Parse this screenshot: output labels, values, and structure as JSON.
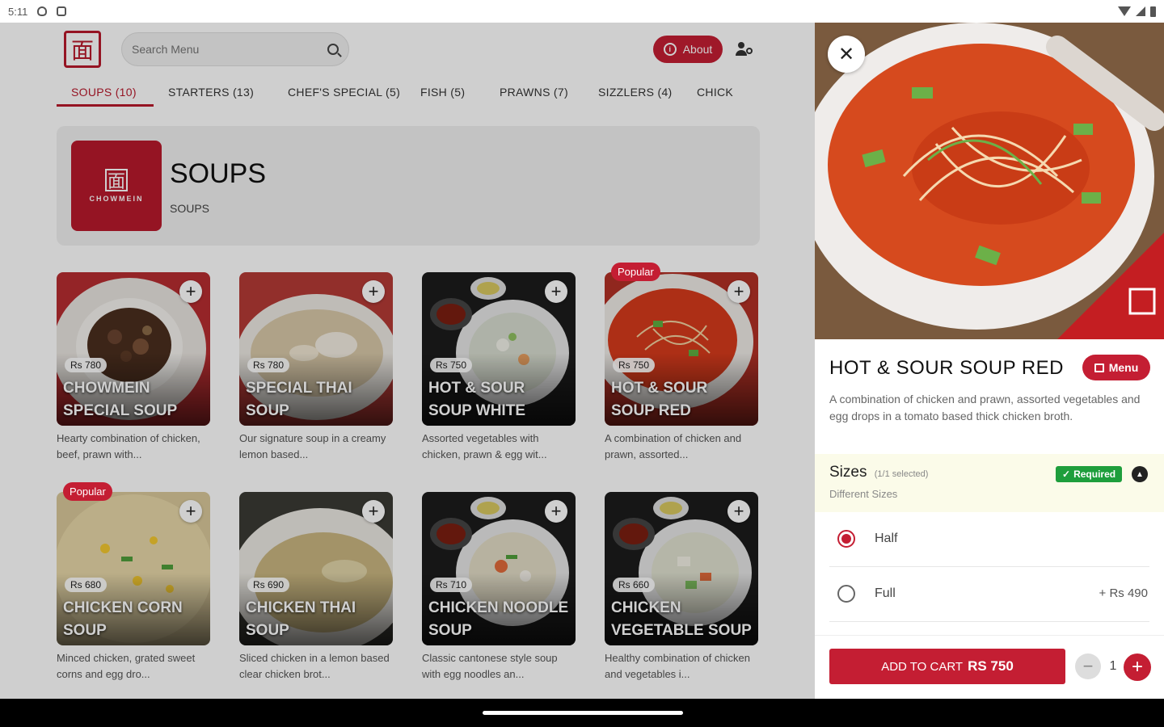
{
  "status": {
    "time": "5:11"
  },
  "header": {
    "logo_glyph": "面",
    "search": {
      "placeholder": "Search Menu",
      "value": ""
    },
    "about_label": "About",
    "about_icon": "i"
  },
  "tabs": [
    "SOUPS (10)",
    "STARTERS (13)",
    "CHEF'S SPECIAL (5)",
    "FISH (5)",
    "PRAWNS (7)",
    "SIZZLERS (4)",
    "CHICK"
  ],
  "category": {
    "logo_glyph": "面",
    "logo_text": "CHOWMEIN",
    "title": "SOUPS",
    "subtitle": "SOUPS"
  },
  "items": [
    {
      "price": "Rs 780",
      "name": "CHOWMEIN SPECIAL SOUP",
      "desc": "Hearty combination of chicken, beef, prawn with...",
      "popular": ""
    },
    {
      "price": "Rs 780",
      "name": "SPECIAL THAI SOUP",
      "desc": "Our signature soup in a creamy lemon based...",
      "popular": ""
    },
    {
      "price": "Rs 750",
      "name": "HOT & SOUR SOUP WHITE",
      "desc": "Assorted vegetables with chicken, prawn & egg wit...",
      "popular": ""
    },
    {
      "price": "Rs 750",
      "name": "HOT & SOUR SOUP RED",
      "desc": "A combination of chicken and prawn, assorted...",
      "popular": "Popular"
    },
    {
      "price": "Rs 680",
      "name": "CHICKEN CORN SOUP",
      "desc": "Minced chicken, grated sweet corns and egg dro...",
      "popular": "Popular"
    },
    {
      "price": "Rs 690",
      "name": "CHICKEN THAI SOUP",
      "desc": "Sliced chicken in a lemon based clear chicken brot...",
      "popular": ""
    },
    {
      "price": "Rs 710",
      "name": "CHICKEN NOODLE SOUP",
      "desc": "Classic cantonese style soup with egg noodles an...",
      "popular": ""
    },
    {
      "price": "Rs 660",
      "name": "CHICKEN VEGETABLE SOUP",
      "desc": "Healthy combination of chicken and vegetables i...",
      "popular": ""
    }
  ],
  "detail": {
    "close_glyph": "✕",
    "title": "HOT & SOUR SOUP RED",
    "menu_label": "Menu",
    "description": "A combination of chicken and prawn, assorted vegetables and egg drops in a tomato based thick chicken broth.",
    "sizes": {
      "title": "Sizes",
      "count": "(1/1 selected)",
      "subtitle": "Different Sizes",
      "required_label": "Required",
      "check_glyph": "✓",
      "collapse_glyph": "▲"
    },
    "options": [
      {
        "label": "Half",
        "price": "",
        "selected": true
      },
      {
        "label": "Full",
        "price": "+ Rs 490",
        "selected": false
      }
    ],
    "cart": {
      "label": "ADD TO CART",
      "amount": "RS 750"
    },
    "qty": {
      "value": "1",
      "minus": "−",
      "plus": "+"
    }
  },
  "colors": {
    "brand": "#c41e33",
    "required": "#1e9e3c",
    "sizes_bg": "#fbfbe9"
  },
  "icons": [
    "search-icon",
    "info-icon",
    "user-settings-icon",
    "close-icon",
    "book-icon",
    "check-icon",
    "chevron-up-icon",
    "plus-icon",
    "minus-icon"
  ]
}
